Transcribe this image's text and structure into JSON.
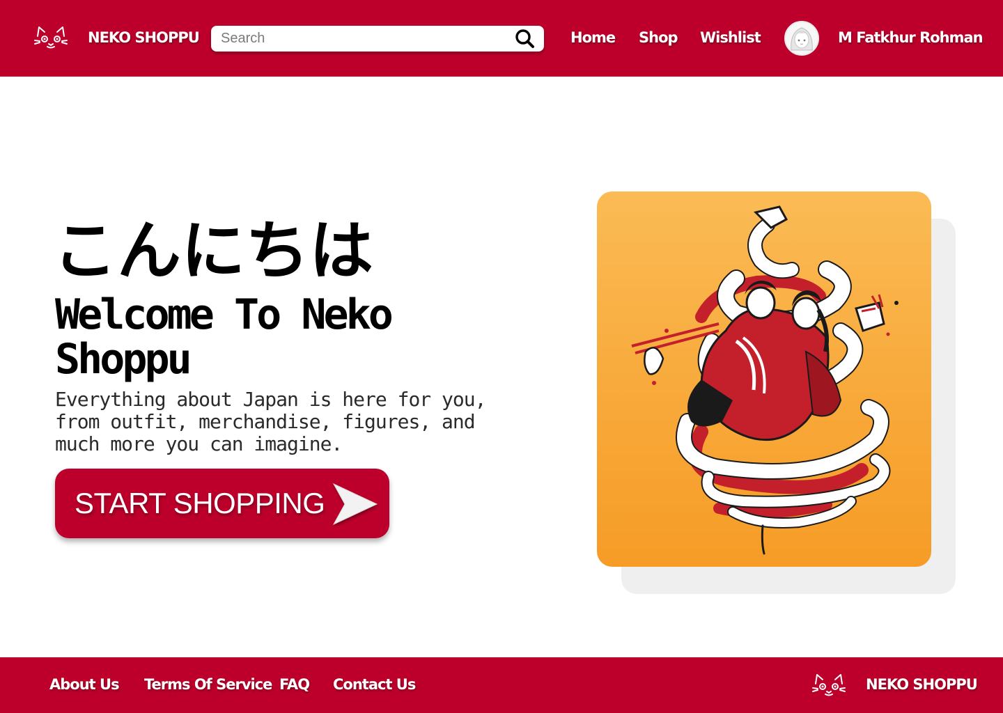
{
  "header": {
    "brand_name": "NEKO SHOPPU",
    "logo_icon": "cat-face-icon",
    "search": {
      "placeholder": "Search",
      "value": "",
      "icon": "search-icon"
    },
    "nav": [
      {
        "label": "Home"
      },
      {
        "label": "Shop"
      },
      {
        "label": "Wishlist"
      }
    ],
    "user": {
      "name": "M Fatkhur Rohman",
      "avatar_icon": "user-avatar"
    }
  },
  "hero": {
    "greeting": "こんにちは",
    "title": "Welcome To Neko Shoppu",
    "description": "Everything about Japan is here for you, from outfit, merchandise, figures, and much more you can imagine.",
    "cta_label": "START SHOPPING",
    "cta_icon": "arrow-right-icon"
  },
  "illustration": {
    "icon": "geisha-ribbon-illustration"
  },
  "footer": {
    "links": [
      {
        "label": "About Us"
      },
      {
        "label": "Terms Of Service"
      },
      {
        "label": "FAQ"
      },
      {
        "label": "Contact Us"
      }
    ],
    "brand_name": "NEKO SHOPPU",
    "logo_icon": "cat-face-icon"
  },
  "colors": {
    "brand_red": "#bd002b",
    "card_orange_top": "#fbbb55",
    "card_orange_bottom": "#f69c26",
    "card_shadow": "#efefef",
    "text_dark": "#000000"
  }
}
